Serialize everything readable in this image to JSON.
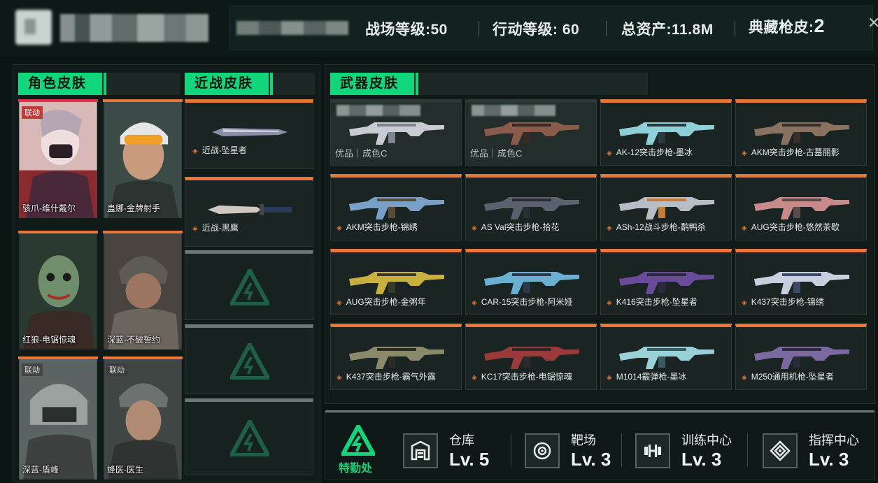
{
  "header": {
    "stats": [
      {
        "label": "战场等级:",
        "value": "50"
      },
      {
        "label": "行动等级: ",
        "value": "60"
      },
      {
        "label": "总资产:",
        "value": "11.8M"
      },
      {
        "label": "典藏枪皮:",
        "value": "2"
      }
    ]
  },
  "sections": {
    "character": "角色皮肤",
    "melee": "近战皮肤",
    "weapon": "武器皮肤"
  },
  "characters": [
    {
      "name": "骇爪-维什戴尔",
      "tag": "联动"
    },
    {
      "name": "蛊娜-金牌射手",
      "tag": ""
    },
    {
      "name": "红狼-电锯惊魂",
      "tag": ""
    },
    {
      "name": "深蓝-不破誓约",
      "tag": ""
    },
    {
      "name": "深蓝-盾峰",
      "tag": "联动"
    },
    {
      "name": "蜂医-医生",
      "tag": "联动"
    }
  ],
  "melee": [
    {
      "name": "近战-坠星者"
    },
    {
      "name": "近战-黑鹰"
    }
  ],
  "weapons": [
    {
      "name": "",
      "sub": "优品｜成色C"
    },
    {
      "name": "",
      "sub": "优品｜成色C"
    },
    {
      "name": "AK-12突击步枪-墨冰",
      "sub": ""
    },
    {
      "name": "AKM突击步枪-古墓丽影",
      "sub": ""
    },
    {
      "name": "AKM突击步枪-锦绣",
      "sub": ""
    },
    {
      "name": "AS Val突击步枪-拾花",
      "sub": ""
    },
    {
      "name": "ASh-12战斗步枪-鹬鸭杀",
      "sub": ""
    },
    {
      "name": "AUG突击步枪-悠然茶歇",
      "sub": ""
    },
    {
      "name": "AUG突击步枪-金粥年",
      "sub": ""
    },
    {
      "name": "CAR-15突击步枪-阿米娅",
      "sub": ""
    },
    {
      "name": "K416突击步枪-坠星者",
      "sub": ""
    },
    {
      "name": "K437突击步枪-锦绣",
      "sub": ""
    },
    {
      "name": "K437突击步枪-霸气外露",
      "sub": ""
    },
    {
      "name": "KC17突击步枪-电锯惊魂",
      "sub": ""
    },
    {
      "name": "M1014霰弹枪-墨冰",
      "sub": ""
    },
    {
      "name": "M250通用机枪-坠星者",
      "sub": ""
    }
  ],
  "facilities": {
    "hq_label": "特勤处",
    "items": [
      {
        "name": "仓库",
        "level": "Lv. 5",
        "icon": "warehouse-icon"
      },
      {
        "name": "靶场",
        "level": "Lv. 3",
        "icon": "target-icon"
      },
      {
        "name": "训练中心",
        "level": "Lv. 3",
        "icon": "dumbbell-icon"
      },
      {
        "name": "指挥中心",
        "level": "Lv. 3",
        "icon": "command-icon"
      }
    ]
  },
  "colors": {
    "accent_green": "#12d67c",
    "rarity_orange": "#e8763a",
    "rarity_red": "#e0304a"
  }
}
